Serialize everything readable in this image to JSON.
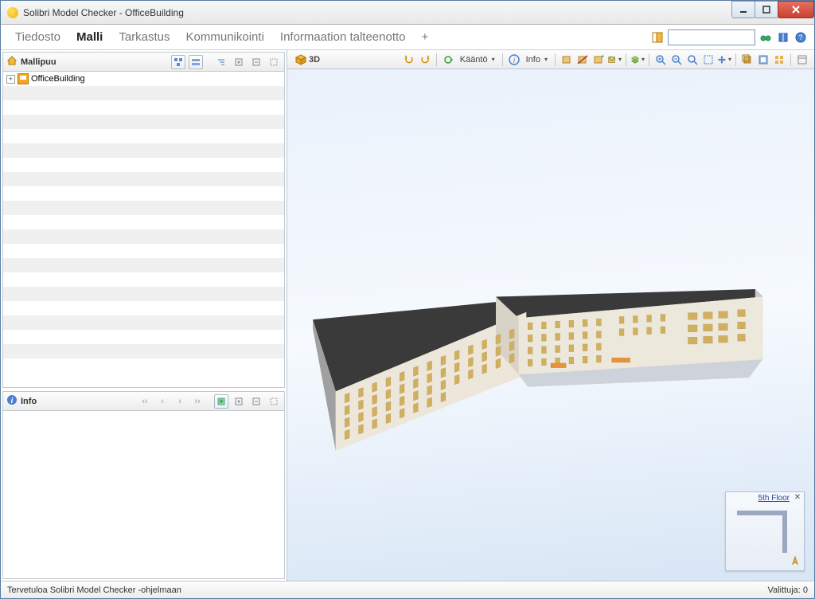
{
  "window": {
    "title": "Solibri Model Checker - OfficeBuilding"
  },
  "menu": {
    "items": [
      "Tiedosto",
      "Malli",
      "Tarkastus",
      "Kommunikointi",
      "Informaation talteenotto",
      "+"
    ],
    "active_index": 1
  },
  "toolbar_right": {
    "icons": [
      "layout-icon"
    ],
    "search_placeholder": "",
    "trailing_icons": [
      "binoculars-icon",
      "book-icon",
      "help-icon"
    ]
  },
  "sidebar": {
    "tree_panel": {
      "title": "Mallipuu",
      "title_icon": "home-icon",
      "header_buttons": [
        "tree-containment-icon",
        "tree-layers-icon",
        "indent-icon",
        "expand-icon",
        "collapse-icon",
        "win-icon"
      ],
      "root": {
        "expander": "+",
        "icon": "model-icon",
        "label": "OfficeBuilding"
      },
      "stripe_rows": 18
    },
    "info_panel": {
      "title": "Info",
      "title_icon": "info-icon",
      "nav_icons": [
        "first-icon",
        "prev-icon",
        "next-icon",
        "last-icon"
      ],
      "header_buttons": [
        "add-view-icon",
        "expand-icon",
        "collapse-icon",
        "win-icon"
      ]
    }
  },
  "viewport": {
    "title": "3D",
    "title_icon": "cube-icon",
    "groups": {
      "history": [
        "undo-icon",
        "redo-icon"
      ],
      "rotate": {
        "label": "Kääntö",
        "dropdown": true
      },
      "info": {
        "icon": "info-icon",
        "label": "Info",
        "dropdown": true
      },
      "boxops": [
        "box-icon",
        "box-cut-icon",
        "box-plus-icon",
        "box-refresh-icon"
      ],
      "layers": {
        "icon": "stack-icon",
        "dropdown": true
      },
      "zoom": [
        "zoom-in-icon",
        "zoom-out-icon",
        "zoom-fit-icon",
        "zoom-area-icon",
        "pan-icon"
      ],
      "clip": [
        "clip-icon",
        "section-icon",
        "grid-icon"
      ],
      "panel": [
        "panel-icon"
      ]
    }
  },
  "minimap": {
    "title": "5th Floor"
  },
  "statusbar": {
    "left": "Tervetuloa Solibri Model Checker -ohjelmaan",
    "right_label": "Valittuja:",
    "right_value": "0"
  }
}
